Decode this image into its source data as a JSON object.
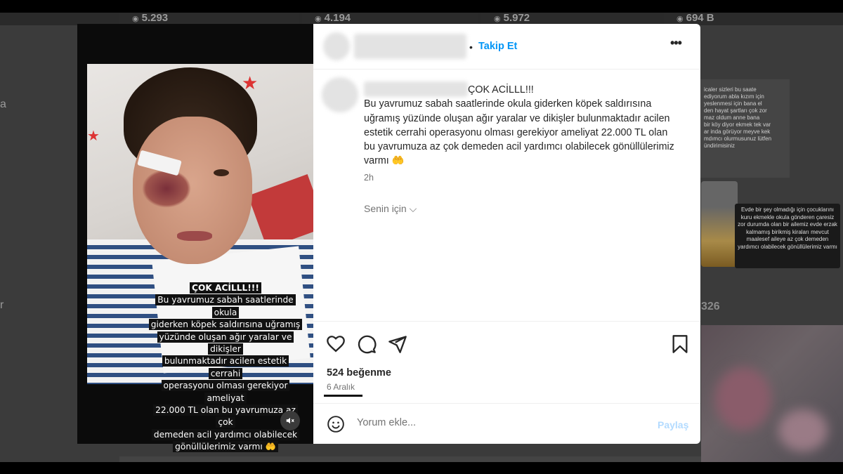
{
  "background_feed": {
    "view_counts": [
      "5.293",
      "4.194",
      "5.972",
      "694 B",
      "326"
    ],
    "side_letters": [
      "a",
      "r"
    ],
    "card_text": "icaler sizleri bu saate\nediyorum abla kızım için\nyeslenmesi için bana el\nden hayat şartları çok zor\nmaz oldum anne bana\nbir köy diyor ekmek tek var\nar inda görüyor meyve kek\nmdımcı olurmusunuz lütfen\nündirimisiniz",
    "caption_card": "Evde bir şey olmadığı için çocuklarını kuru ekmekle okula gönderen çaresiz zor durumda olan bir ailemiz evde erzak kalmamış birikmiş kiraları mevcut maalesef aileye az çok demeden yardımcı olabilecek gönüllülerimiz varmı"
  },
  "story": {
    "caption_lines": [
      "ÇOK ACİLLL!!!",
      "Bu yavrumuz sabah saatlerinde okula",
      "giderken köpek saldırısına uğramış",
      "yüzünde oluşan ağır yaralar ve dikişler",
      "bulunmaktadır acilen estetik cerrahi",
      "operasyonu olması gerekiyor ameliyat",
      "22.000 TL olan bu yavrumuza az çok",
      "demeden acil yardımcı olabilecek",
      "gönüllülerimiz varmı 🤲"
    ]
  },
  "post": {
    "header": {
      "separator": "•",
      "follow_label": "Takip Et",
      "more_label": "•••"
    },
    "caption": {
      "title": "ÇOK ACİLLL!!!",
      "body": "Bu yavrumuz sabah saatlerinde okula giderken köpek saldırısına uğramış yüzünde oluşan ağır yaralar ve dikişler bulunmaktadır acilen estetik cerrahi operasyonu olması gerekiyor ameliyat 22.000 TL olan bu yavrumuza az çok demeden acil yardımcı olabilecek gönüllülerimiz varmı 🤲",
      "time_ago": "2h",
      "for_you": "Senin için ⌵"
    },
    "likes": "524 beğenme",
    "date": "6 Aralık",
    "comment": {
      "placeholder": "Yorum ekle...",
      "share_label": "Paylaş"
    }
  },
  "icons": [
    "heart-icon",
    "comment-icon",
    "share-icon",
    "bookmark-icon",
    "emoji-icon",
    "mute-icon",
    "more-icon"
  ]
}
